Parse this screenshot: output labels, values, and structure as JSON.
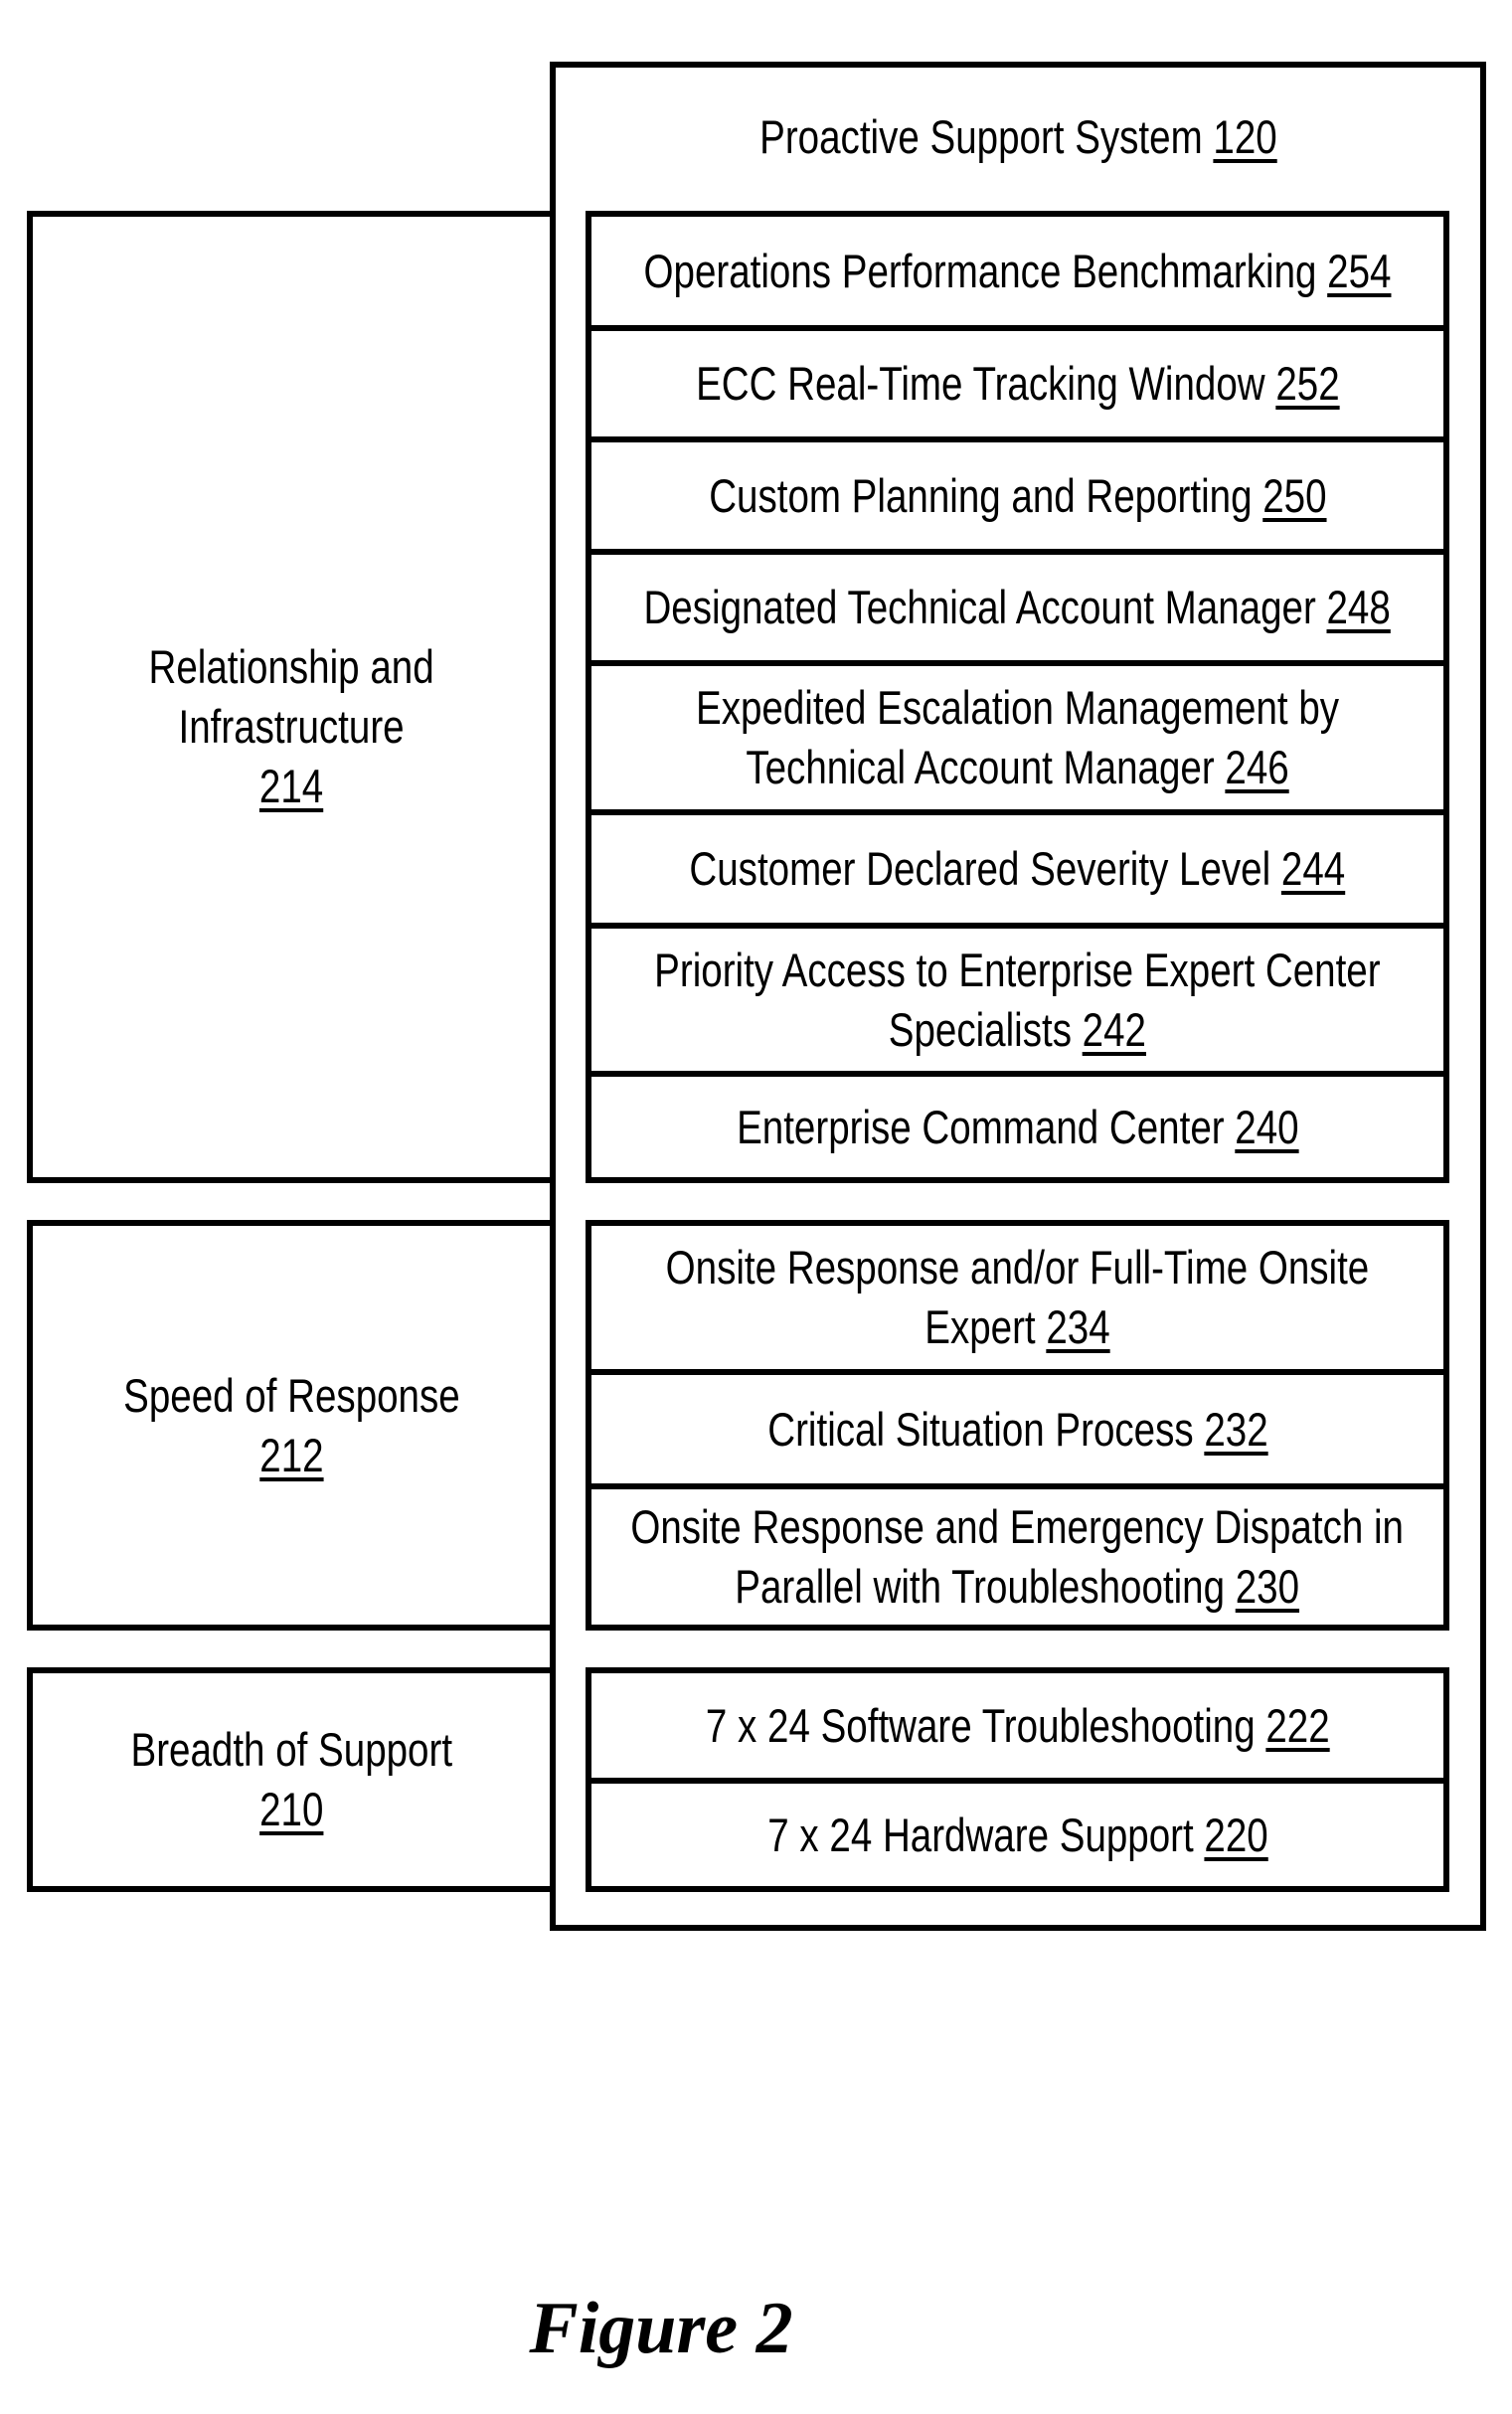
{
  "diagram": {
    "system": {
      "label": "Proactive Support System",
      "ref": "120"
    },
    "categories": [
      {
        "label_line1": "Relationship and",
        "label_line2": "Infrastructure",
        "ref": "214"
      },
      {
        "label_line1": "Speed of Response",
        "ref": "212"
      },
      {
        "label_line1": "Breadth of Support",
        "ref": "210"
      }
    ],
    "features": [
      {
        "line1": "Operations Performance Benchmarking",
        "line2": "",
        "ref": "254",
        "category": "214"
      },
      {
        "line1": "ECC Real-Time Tracking Window",
        "line2": "",
        "ref": "252",
        "category": "214"
      },
      {
        "line1": "Custom Planning and Reporting",
        "line2": "",
        "ref": "250",
        "category": "214"
      },
      {
        "line1": "Designated Technical Account Manager",
        "line2": "",
        "ref": "248",
        "category": "214"
      },
      {
        "line1": "Expedited Escalation Management by",
        "line2": "Technical Account Manager",
        "ref": "246",
        "category": "214"
      },
      {
        "line1": "Customer Declared Severity Level",
        "line2": "",
        "ref": "244",
        "category": "214"
      },
      {
        "line1": "Priority Access to Enterprise Expert Center",
        "line2": "Specialists",
        "ref": "242",
        "category": "214"
      },
      {
        "line1": "Enterprise Command Center",
        "line2": "",
        "ref": "240",
        "category": "214"
      },
      {
        "line1": "Onsite Response and/or Full-Time Onsite",
        "line2": "Expert",
        "ref": "234",
        "category": "212"
      },
      {
        "line1": "Critical Situation Process",
        "line2": "",
        "ref": "232",
        "category": "212"
      },
      {
        "line1": "Onsite Response and Emergency Dispatch in",
        "line2": "Parallel with Troubleshooting",
        "ref": "230",
        "category": "212"
      },
      {
        "line1": "7 x 24 Software Troubleshooting",
        "line2": "",
        "ref": "222",
        "category": "210"
      },
      {
        "line1": "7 x 24 Hardware Support",
        "line2": "",
        "ref": "220",
        "category": "210"
      }
    ],
    "caption": "Figure 2"
  }
}
